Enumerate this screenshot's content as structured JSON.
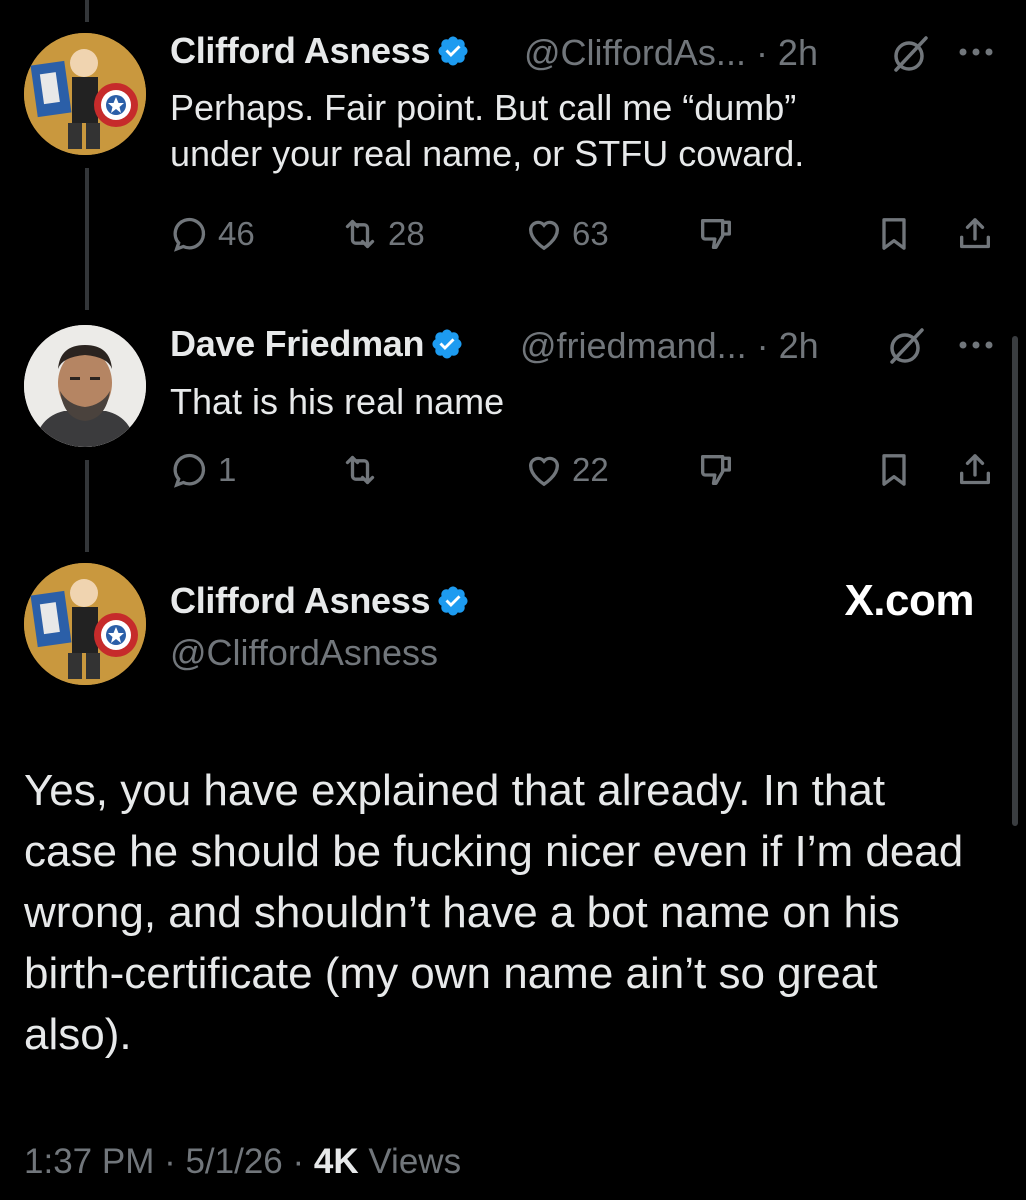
{
  "colors": {
    "background": "#000000",
    "text": "#e7e9ea",
    "muted": "#71767b",
    "verified": "#1d9bf0"
  },
  "tweet1": {
    "name": "Clifford Asness",
    "handle_meta": "@CliffordAs... · 2h",
    "text_lines": [
      "Perhaps. Fair point. But call me “dumb”",
      "under your real name, or STFU coward."
    ],
    "replies": "46",
    "reposts": "28",
    "likes": "63"
  },
  "tweet2": {
    "name": "Dave Friedman",
    "handle_meta": "@friedmand... · 2h",
    "text_lines": [
      "That is his real name"
    ],
    "replies": "1",
    "reposts": "",
    "likes": "22"
  },
  "main_tweet": {
    "name": "Clifford Asness",
    "handle": "@CliffordAsness",
    "brand": "X.com",
    "text": "Yes, you have explained that already. In that case he should be fucking nicer even if I’m dead wrong, and shouldn’t have a bot name on his birth-certificate (my own name ain’t so great also).",
    "time_date": "1:37 PM · 5/1/26 · ",
    "views_count": "4K",
    "views_label": " Views"
  },
  "icons": [
    "reply-icon",
    "repost-icon",
    "like-icon",
    "dislike-icon",
    "bookmark-icon",
    "share-icon",
    "grok-icon",
    "more-icon",
    "verified-icon"
  ]
}
